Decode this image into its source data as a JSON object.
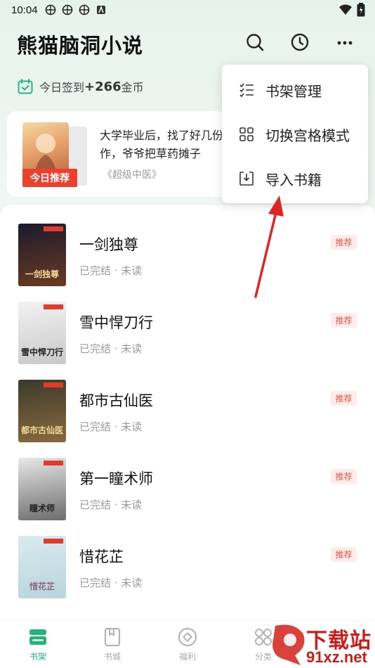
{
  "status_bar": {
    "time": "10:04"
  },
  "header": {
    "title": "熊猫脑洞小说"
  },
  "checkin": {
    "prefix": "今日签到",
    "amount": "+266",
    "suffix": "金币"
  },
  "recommend": {
    "badge": "今日推荐",
    "text": "大学毕业后，找了好几份工作，爷爷把草药摊子",
    "book": "《超级中医》"
  },
  "menu": {
    "items": [
      {
        "label": "书架管理",
        "icon": "checklist-icon"
      },
      {
        "label": "切换宫格模式",
        "icon": "grid-icon"
      },
      {
        "label": "导入书籍",
        "icon": "import-icon"
      }
    ]
  },
  "books": [
    {
      "title": "一剑独尊",
      "status": "已完结 · 未读",
      "badge": "推荐",
      "cover_text": "一剑独尊",
      "colors": [
        "#1c1a2e",
        "#6a3a22"
      ]
    },
    {
      "title": "雪中悍刀行",
      "status": "已完结 · 未读",
      "badge": "推荐",
      "cover_text": "雪中悍刀行",
      "colors": [
        "#f2f2f2",
        "#c9c9c9"
      ]
    },
    {
      "title": "都市古仙医",
      "status": "已完结 · 未读",
      "badge": "推荐",
      "cover_text": "都市古仙医",
      "colors": [
        "#3b3a2c",
        "#8a6a3e"
      ]
    },
    {
      "title": "第一瞳术师",
      "status": "已完结 · 未读",
      "badge": "推荐",
      "cover_text": "瞳术师",
      "colors": [
        "#e8e8e8",
        "#6c6c6c"
      ]
    },
    {
      "title": "惜花芷",
      "status": "已完结 · 未读",
      "badge": "推荐",
      "cover_text": "惜花芷",
      "colors": [
        "#d9ebf0",
        "#b8d4dc"
      ]
    }
  ],
  "bottom_nav": [
    {
      "label": "书架",
      "icon": "bookshelf-icon",
      "active": true
    },
    {
      "label": "书城",
      "icon": "bookstore-icon",
      "active": false
    },
    {
      "label": "福利",
      "icon": "welfare-icon",
      "active": false
    },
    {
      "label": "分类",
      "icon": "category-icon",
      "active": false
    }
  ],
  "watermark": {
    "text1": "下载站",
    "text2": "91xz.net"
  },
  "colors": {
    "accent": "#22b57a",
    "badge_red": "#e9402f",
    "arrow_red": "#e02424"
  }
}
